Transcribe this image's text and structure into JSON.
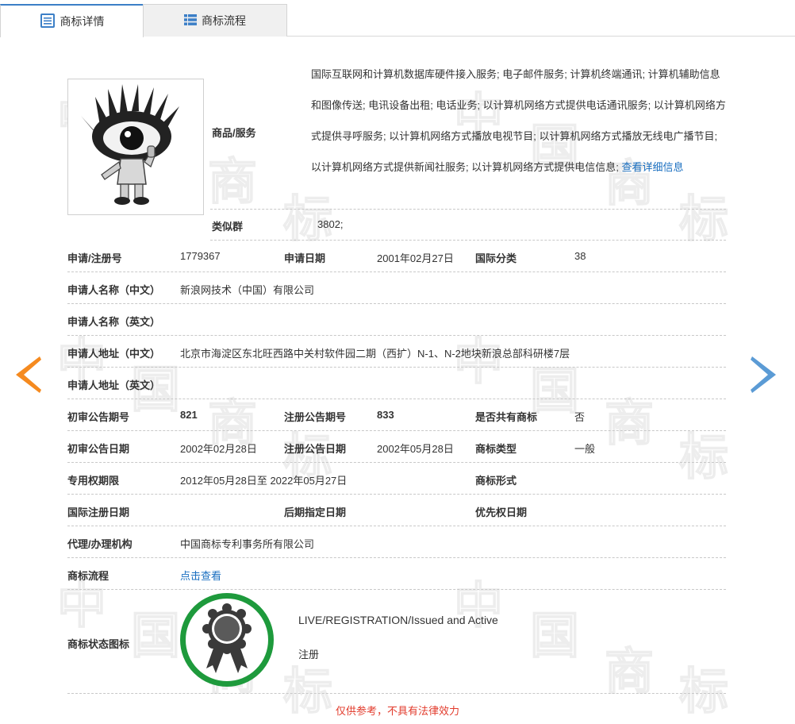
{
  "tabs": [
    {
      "label": "商标详情",
      "active": true,
      "icon": "document-list-icon"
    },
    {
      "label": "商标流程",
      "active": false,
      "icon": "grid-list-icon"
    }
  ],
  "watermark": [
    "中",
    "国",
    "商",
    "标"
  ],
  "goods_services": {
    "label": "商品/服务",
    "text": "国际互联网和计算机数据库硬件接入服务; 电子邮件服务; 计算机终端通讯; 计算机辅助信息和图像传送; 电讯设备出租; 电话业务; 以计算机网络方式提供电话通讯服务; 以计算机网络方式提供寻呼服务; 以计算机网络方式播放电视节目; 以计算机网络方式播放无线电广播节目; 以计算机网络方式提供新闻社服务; 以计算机网络方式提供电信信息; ",
    "link": "查看详细信息"
  },
  "similar_group": {
    "label": "类似群",
    "value": "3802;"
  },
  "rows": {
    "reg_no": {
      "label": "申请/注册号",
      "value": "1779367"
    },
    "app_date": {
      "label": "申请日期",
      "value": "2001年02月27日"
    },
    "intl_class": {
      "label": "国际分类",
      "value": "38"
    },
    "applicant_cn": {
      "label": "申请人名称（中文）",
      "value": "新浪网技术（中国）有限公司"
    },
    "applicant_en": {
      "label": "申请人名称（英文）",
      "value": ""
    },
    "address_cn": {
      "label": "申请人地址（中文）",
      "value": "北京市海淀区东北旺西路中关村软件园二期（西扩）N-1、N-2地块新浪总部科研楼7层"
    },
    "address_en": {
      "label": "申请人地址（英文）",
      "value": ""
    },
    "prelim_no": {
      "label": "初审公告期号",
      "value": "821"
    },
    "reg_pub_no": {
      "label": "注册公告期号",
      "value": "833"
    },
    "shared": {
      "label": "是否共有商标",
      "value": "否"
    },
    "prelim_date": {
      "label": "初审公告日期",
      "value": "2002年02月28日"
    },
    "reg_pub_date": {
      "label": "注册公告日期",
      "value": "2002年05月28日"
    },
    "tm_type": {
      "label": "商标类型",
      "value": "一般"
    },
    "exclusive_period": {
      "label": "专用权期限",
      "value": "2012年05月28日至 2022年05月27日"
    },
    "tm_form": {
      "label": "商标形式",
      "value": ""
    },
    "intl_reg_date": {
      "label": "国际注册日期",
      "value": ""
    },
    "later_date": {
      "label": "后期指定日期",
      "value": ""
    },
    "priority_date": {
      "label": "优先权日期",
      "value": ""
    },
    "agent": {
      "label": "代理/办理机构",
      "value": "中国商标专利事务所有限公司"
    },
    "flow": {
      "label": "商标流程",
      "link": "点击查看"
    }
  },
  "status": {
    "label": "商标状态图标",
    "en": "LIVE/REGISTRATION/Issued and Active",
    "cn": "注册",
    "ring_color": "#1e9a3c"
  },
  "footer": "仅供参考，不具有法律效力",
  "colors": {
    "accent": "#3c7fc7",
    "link": "#1a6fc0",
    "warning": "#e23b2c",
    "arrow_left": "#f58a1f",
    "arrow_right": "#5b9bd5"
  }
}
